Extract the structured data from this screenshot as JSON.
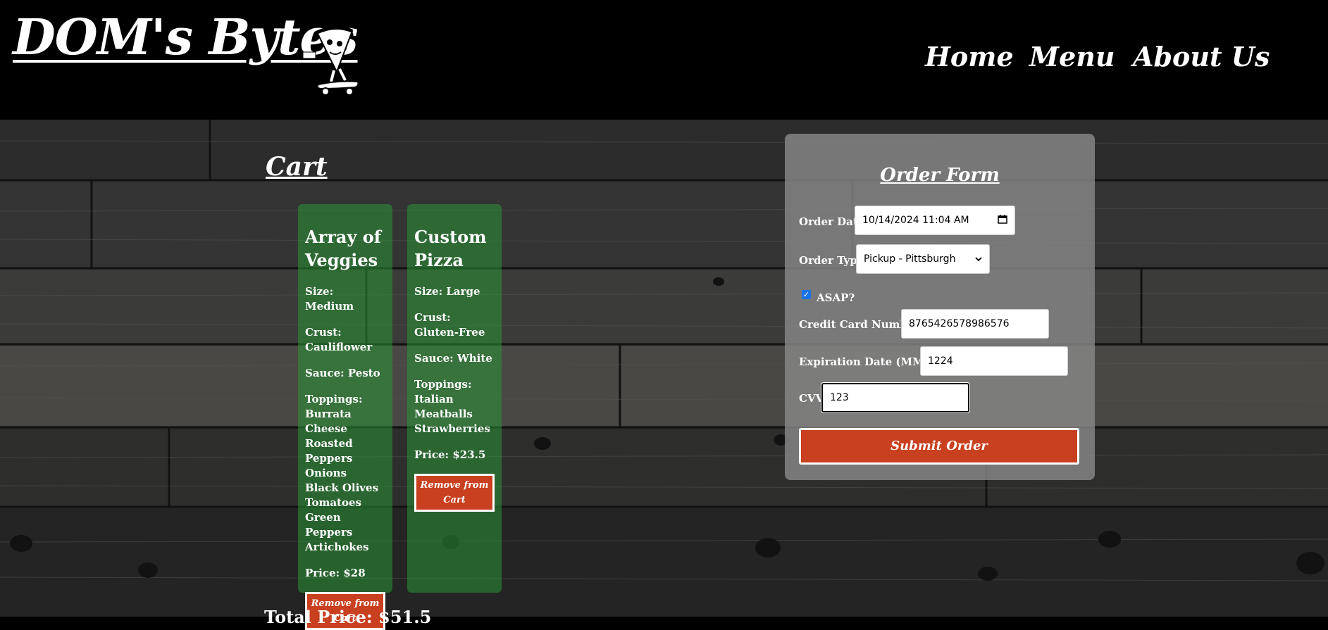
{
  "header": {
    "logo_text": "DOM's Bytes",
    "nav": [
      "Home",
      "Menu",
      "About Us"
    ]
  },
  "cart": {
    "title": "Cart",
    "items": [
      {
        "name": "Array of Veggies",
        "size": "Size: Medium",
        "crust": "Crust: Cauliflower",
        "sauce": "Sauce: Pesto",
        "toppings_label": "Toppings:",
        "toppings": [
          "Burrata Cheese",
          "Roasted Peppers",
          "Onions",
          "Black Olives",
          "Tomatoes",
          "Green Peppers",
          "Artichokes"
        ],
        "price": "Price: $28",
        "remove_label": "Remove from Cart"
      },
      {
        "name": "Custom Pizza",
        "size": "Size: Large",
        "crust": "Crust: Gluten-Free",
        "sauce": "Sauce: White",
        "toppings_label": "Toppings:",
        "toppings": [
          "Italian Meatballs",
          "Strawberries"
        ],
        "price": "Price: $23.5",
        "remove_label": "Remove from Cart"
      }
    ],
    "total": "Total Price: $51.5"
  },
  "order_form": {
    "title": "Order Form",
    "order_date_label": "Order Date",
    "order_date_value": "10/14/2024 11:04 AM",
    "order_type_label": "Order Type",
    "order_type_value": "Pickup - Pittsburgh",
    "asap_label": "ASAP?",
    "asap_checked": true,
    "cc_label": "Credit Card Number",
    "cc_value": "8765426578986576",
    "exp_label": "Expiration Date (MMYY)",
    "exp_value": "1224",
    "cvv_label": "CVV",
    "cvv_value": "123",
    "submit_label": "Submit Order"
  },
  "colors": {
    "accent_red": "#c8401f",
    "card_green": "#2a9637",
    "panel_gray": "#878787",
    "checkbox_blue": "#1a73e8"
  },
  "icons": {
    "mascot": "pizza-skateboard-mascot-icon",
    "calendar": "calendar-icon",
    "dropdown": "chevron-down-icon",
    "checkbox": "checkmark-icon"
  }
}
